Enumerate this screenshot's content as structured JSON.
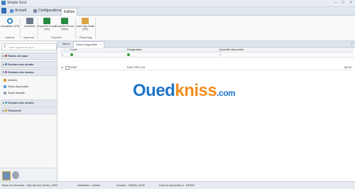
{
  "window": {
    "title": "Simple Gest"
  },
  "menu_tabs": [
    {
      "label": "Accueil",
      "active": false
    },
    {
      "label": "Configurations",
      "active": false
    },
    {
      "label": "Edition",
      "active": true
    }
  ],
  "ribbon": {
    "buttons": [
      {
        "label": "Actualiser (F5)",
        "icon": "refresh-icon"
      },
      {
        "label": "Imprimer",
        "icon": "printer-icon"
      },
      {
        "label": "Exporter Excel (xls)",
        "icon": "excel-icon"
      },
      {
        "label": "Exporter Excel (xlsx)",
        "icon": "excel-icon"
      },
      {
        "label": "Liste des états (F8)",
        "icon": "report-list-icon"
      }
    ],
    "groups": [
      "Actions",
      "Imprimer",
      "Exporter",
      "Reporting"
    ]
  },
  "nav": {
    "search_placeholder": "Tape keywords here",
    "groups": [
      {
        "label": "Tables de base",
        "expanded": false
      },
      {
        "label": "Gestion des achats",
        "expanded": false
      },
      {
        "label": "Gestion des stocks",
        "expanded": true
      },
      {
        "label": "Gestion des ventes",
        "expanded": false
      },
      {
        "label": "Trésorerie",
        "expanded": false
      }
    ],
    "stock_items": [
      "Articles",
      "Stock disponible",
      "Stock détaillé"
    ]
  },
  "doc_tabs": [
    {
      "label": "Menu",
      "active": false
    },
    {
      "label": "Stock Disponible",
      "active": true
    }
  ],
  "grid": {
    "columns": [
      "Code",
      "Désignation",
      "Quantité disponible"
    ],
    "filter_row": {
      "quantity_operator": "="
    },
    "rows": [
      {
        "code": "2000",
        "designation": "EAU IFRI 1.5L",
        "quantity": "84,00"
      }
    ]
  },
  "watermark": {
    "part1": "Oued",
    "part2": "kniss",
    "part3": ".com"
  },
  "statusbar": {
    "database": "Base de données : SQLServer) Demo_2022",
    "user": "Utilisateur : Admin",
    "folder": "Dossier : DEMO_2022",
    "license": "Licence accordée à : DEMO"
  },
  "colors": {
    "accent": "#2f6fb5",
    "filter_icon": "#3c9b3c",
    "watermark_blue": "#1f73c9",
    "watermark_orange": "#f28c1e"
  }
}
